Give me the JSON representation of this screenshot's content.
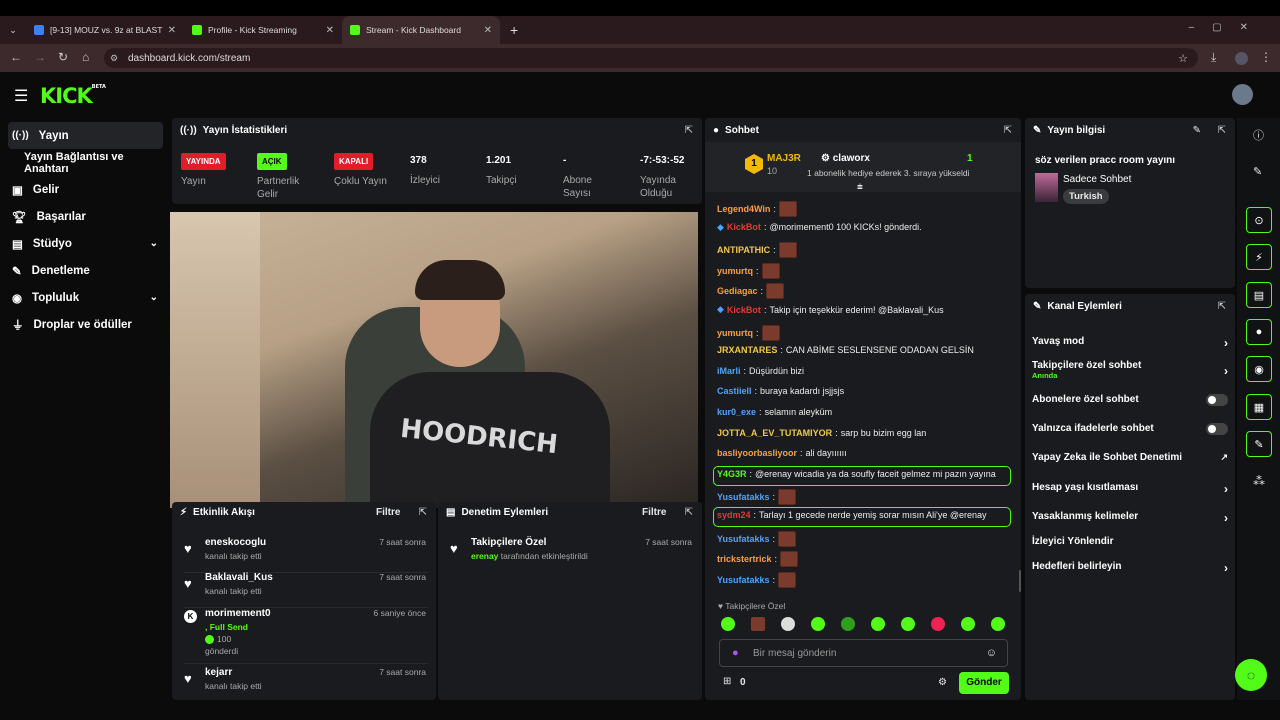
{
  "browser": {
    "tabs": [
      {
        "label": "[9-13] MOUZ vs. 9z at BLAST C",
        "favicon_color": "#3b82f6"
      },
      {
        "label": "Profile - Kick Streaming",
        "favicon_color": "#53fc18"
      },
      {
        "label": "Stream - Kick Dashboard",
        "favicon_color": "#53fc18"
      }
    ],
    "url": "dashboard.kick.com/stream"
  },
  "brand": {
    "logo": "KICK",
    "tag": "BETA",
    "accent": "#53fc18"
  },
  "sidebar": {
    "items": [
      {
        "label": "Yayın",
        "icon": "broadcast-icon"
      },
      {
        "label": "Yayın Bağlantısı ve Anahtarı",
        "icon": ""
      },
      {
        "label": "Gelir",
        "icon": "dollar-icon"
      },
      {
        "label": "Başarılar",
        "icon": "trophy-icon"
      },
      {
        "label": "Stüdyo",
        "icon": "studio-icon"
      },
      {
        "label": "Denetleme",
        "icon": "wrench-icon"
      },
      {
        "label": "Topluluk",
        "icon": "people-icon"
      },
      {
        "label": "Droplar ve ödüller",
        "icon": "drops-icon"
      }
    ]
  },
  "stats": {
    "title": "Yayın İstatistikleri",
    "items": [
      {
        "badge": "YAYINDA",
        "label": "Yayın"
      },
      {
        "badge": "AÇIK",
        "label": "Partnerlik Gelir"
      },
      {
        "badge": "KAPALI",
        "label": "Çoklu Yayın"
      },
      {
        "value": "378",
        "label": "İzleyici"
      },
      {
        "value": "1.201",
        "label": "Takipçi"
      },
      {
        "value": "-",
        "label": "Abone Sayısı"
      },
      {
        "value": "-7:-53:-52",
        "label": "Yayında Olduğu"
      }
    ]
  },
  "activity": {
    "title": "Etkinlik Akışı",
    "filter": "Filtre",
    "items": [
      {
        "name": "eneskocoglu",
        "sub": "kanalı takip etti",
        "time": "7 saat sonra"
      },
      {
        "name": "Baklavali_Kus",
        "sub": "kanalı takip etti",
        "time": "7 saat sonra"
      },
      {
        "name": "morimement0",
        "sub1": ", Full Send",
        "amount": "100",
        "sub": "gönderdi",
        "time": "6 saniye önce"
      },
      {
        "name": "kejarr",
        "sub": "kanalı takip etti",
        "time": "7 saat sonra"
      }
    ]
  },
  "moderation": {
    "title": "Denetim Eylemleri",
    "filter": "Filtre",
    "item_title": "Takipçilere Özel",
    "item_user": "erenay",
    "item_sub": "tarafından etkinleştirildi",
    "item_time": "7 saat sonra"
  },
  "chat": {
    "title": "Sohbet",
    "pinned_rank": "1",
    "pinned_user": "MAJ3R",
    "pinned_count": "10",
    "pinned_gifter": "claworx",
    "pinned_gift_count": "1",
    "pinned_text": "1 abonelik hediye ederek 3. sıraya yükseldi",
    "messages": [
      {
        "user": "Legend4Win",
        "color": "#ff9d3c",
        "text": "",
        "emote": true
      },
      {
        "user": "KickBot",
        "color": "#e53935",
        "text": "@morimement0 100 KICKs! gönderdi.",
        "emote": false
      },
      {
        "user": "ANTIPATHIC",
        "color": "#f2c94c",
        "text": "",
        "emote": true
      },
      {
        "user": "yumurtq",
        "color": "#ff9d3c",
        "text": "",
        "emote": true
      },
      {
        "user": "Gediagac",
        "color": "#ff9d3c",
        "text": "",
        "emote": true
      },
      {
        "user": "KickBot",
        "color": "#e53935",
        "text": "Takip için teşekkür ederim! @Baklavali_Kus",
        "emote": false
      },
      {
        "user": "yumurtq",
        "color": "#ff9d3c",
        "text": "",
        "emote": true
      },
      {
        "user": "JRXANTARES",
        "color": "#f2c94c",
        "text": "CAN ABİME SESLENSENE ODADAN GELSİN",
        "emote": false
      },
      {
        "user": "iMarli",
        "color": "#4fa3ff",
        "text": "Düşürdün bizi",
        "emote": false
      },
      {
        "user": "Castiiell",
        "color": "#4fa3ff",
        "text": "buraya kadardı jsjjsjs",
        "emote": false
      },
      {
        "user": "kur0_exe",
        "color": "#4fa3ff",
        "text": "selamın aleyküm",
        "emote": false
      },
      {
        "user": "JOTTA_A_EV_TUTAMIYOR",
        "color": "#f2c94c",
        "text": "sarp bu bizim egg lan",
        "emote": false
      },
      {
        "user": "basliyoorbasliyoor",
        "color": "#ff9d3c",
        "text": "ali dayıııııı",
        "emote": false
      },
      {
        "user": "Y4G3R",
        "color": "#53fc18",
        "text": "@erenay wicadia ya da soufly faceit gelmez mi pazın yayına",
        "emote": false
      },
      {
        "user": "Yusufatakks",
        "color": "#4fa3ff",
        "text": "",
        "emote": true
      },
      {
        "user": "sydm24",
        "color": "#e53935",
        "text": "Tarlayı 1 gecede nerde yemiş sorar mısın Ali'ye @erenay",
        "emote": false
      },
      {
        "user": "Yusufatakks",
        "color": "#4fa3ff",
        "text": "",
        "emote": true
      },
      {
        "user": "trickstertrick",
        "color": "#ff9d3c",
        "text": "",
        "emote": true
      },
      {
        "user": "Yusufatakks",
        "color": "#4fa3ff",
        "text": "",
        "emote": true
      }
    ],
    "mode_label": "Takipçilere Özel",
    "placeholder": "Bir mesaj gönderin",
    "kicks": "0",
    "send": "Gönder"
  },
  "stream_info": {
    "title": "Yayın bilgisi",
    "stream_title": "söz verilen pracc room yayını",
    "category": "Sadece Sohbet",
    "tag": "Turkish"
  },
  "channel_actions": {
    "title": "Kanal Eylemleri",
    "items": [
      {
        "label": "Yavaş mod",
        "control": "arrow"
      },
      {
        "label": "Takipçilere özel sohbet",
        "sub": "Anında",
        "control": "arrow"
      },
      {
        "label": "Abonelere özel sohbet",
        "control": "toggle"
      },
      {
        "label": "Yalnızca ifadelerle sohbet",
        "control": "toggle"
      },
      {
        "label": "Yapay Zeka ile Sohbet Denetimi",
        "control": "external"
      },
      {
        "label": "Hesap yaşı kısıtlaması",
        "control": "arrow"
      },
      {
        "label": "Yasaklanmış kelimeler",
        "control": "arrow"
      },
      {
        "label": "İzleyici Yönlendir",
        "control": "none"
      },
      {
        "label": "Hedefleri belirleyin",
        "control": "arrow"
      }
    ]
  },
  "video": {
    "caption": "HOODRICH"
  }
}
